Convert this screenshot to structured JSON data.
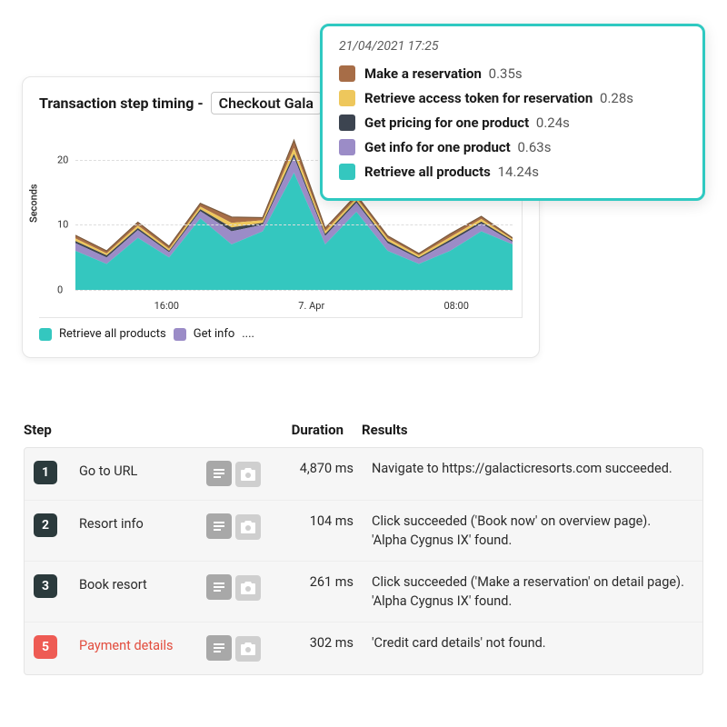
{
  "card": {
    "title_prefix": "Transaction step timing - ",
    "dropdown_value": "Checkout Gala"
  },
  "tooltip": {
    "timestamp": "21/04/2021 17:25",
    "items": [
      {
        "color": "#a76d47",
        "label": "Make a reservation",
        "value": "0.35s"
      },
      {
        "color": "#eec75c",
        "label": "Retrieve access token for reservation",
        "value": "0.28s"
      },
      {
        "color": "#3c4450",
        "label": "Get pricing for one product",
        "value": "0.24s"
      },
      {
        "color": "#9b8cc7",
        "label": "Get info for one product",
        "value": "0.63s"
      },
      {
        "color": "#34c7bf",
        "label": "Retrieve all products",
        "value": "14.24s"
      }
    ]
  },
  "chart_legend": {
    "items": [
      {
        "color": "#34c7bf",
        "label": "Retrieve all products"
      },
      {
        "color": "#9b8cc7",
        "label": "Get info"
      }
    ],
    "more": "...."
  },
  "chart_data": {
    "type": "area",
    "title": "Transaction step timing - Checkout Gala",
    "ylabel": "Seconds",
    "xlabel": "",
    "ylim": [
      0,
      25
    ],
    "yticks": [
      0,
      10,
      20
    ],
    "xticks": [
      "16:00",
      "7. Apr",
      "08:00"
    ],
    "x": [
      0,
      1,
      2,
      3,
      4,
      5,
      6,
      7,
      8,
      9,
      10,
      11,
      12,
      13,
      14
    ],
    "series": [
      {
        "name": "Retrieve all products",
        "color": "#34c7bf",
        "values": [
          6,
          4,
          8,
          5,
          11,
          7,
          9,
          18,
          7,
          12,
          6,
          4,
          6,
          9,
          7
        ]
      },
      {
        "name": "Get info for one product",
        "color": "#9b8cc7",
        "values": [
          1.2,
          1.0,
          1.2,
          0.8,
          1.1,
          2.0,
          1.0,
          2.4,
          1.3,
          1.4,
          1.2,
          0.8,
          1.4,
          1.2,
          0.4
        ]
      },
      {
        "name": "Get pricing for one product",
        "color": "#3c4450",
        "values": [
          0.3,
          0.3,
          0.3,
          0.2,
          0.3,
          0.6,
          0.3,
          0.5,
          0.3,
          0.3,
          0.3,
          0.2,
          0.3,
          0.3,
          0.2
        ]
      },
      {
        "name": "Retrieve access token for reservation",
        "color": "#eec75c",
        "values": [
          0.4,
          0.3,
          0.4,
          0.3,
          0.4,
          0.7,
          0.4,
          0.9,
          0.4,
          0.4,
          0.4,
          0.3,
          0.4,
          0.4,
          0.2
        ]
      },
      {
        "name": "Make a reservation",
        "color": "#a76d47",
        "values": [
          0.5,
          0.4,
          0.5,
          0.4,
          0.5,
          0.9,
          0.4,
          1.2,
          0.5,
          0.5,
          0.4,
          0.3,
          0.5,
          0.4,
          0.2
        ]
      }
    ]
  },
  "table": {
    "headers": {
      "step": "Step",
      "duration": "Duration",
      "results": "Results"
    },
    "rows": [
      {
        "num": "1",
        "error": false,
        "name": "Go to URL",
        "duration": "4,870 ms",
        "results": [
          "Navigate to https://galacticresorts.com succeeded."
        ]
      },
      {
        "num": "2",
        "error": false,
        "name": "Resort info",
        "duration": "104 ms",
        "results": [
          "Click succeeded ('Book now' on overview page).",
          "'Alpha Cygnus IX' found."
        ]
      },
      {
        "num": "3",
        "error": false,
        "name": "Book resort",
        "duration": "261 ms",
        "results": [
          "Click succeeded ('Make a reservation' on detail page).",
          "'Alpha Cygnus IX' found."
        ]
      },
      {
        "num": "5",
        "error": true,
        "name": "Payment details",
        "duration": "302 ms",
        "results": [
          "'Credit card details' not found."
        ]
      }
    ]
  },
  "icons": {
    "log": "log-icon",
    "screenshot": "camera-icon"
  }
}
